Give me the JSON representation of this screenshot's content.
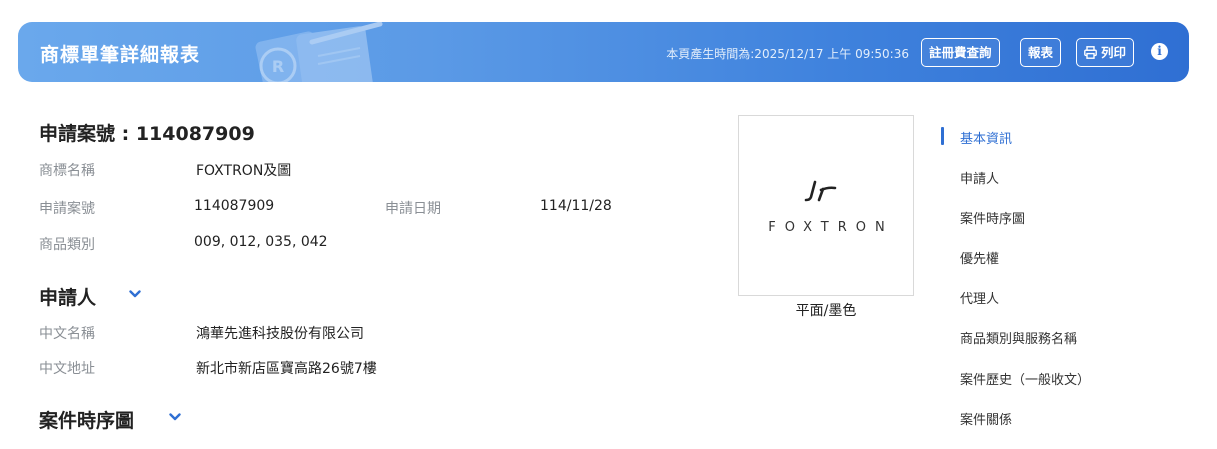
{
  "header": {
    "title": "商標單筆詳細報表",
    "timestamp": "本頁產生時間為:2025/12/17 上午 09:50:36",
    "btn_fee": "註冊費查詢",
    "btn_report": "報表",
    "btn_print": "列印",
    "info_icon": "i"
  },
  "basic": {
    "heading": "申請案號 : 114087909",
    "trademark_name_label": "商標名稱",
    "trademark_name": "FOXTRON及圖",
    "app_no_label": "申請案號",
    "app_no": "114087909",
    "app_date_label": "申請日期",
    "app_date": "114/11/28",
    "class_label": "商品類別",
    "classes": "009, 012, 035, 042"
  },
  "applicant": {
    "heading": "申請人",
    "cn_name_label": "中文名稱",
    "cn_name": "鴻華先進科技股份有限公司",
    "cn_addr_label": "中文地址",
    "cn_addr": "新北市新店區寶高路26號7樓"
  },
  "timeline": {
    "heading": "案件時序圖"
  },
  "image": {
    "wordmark": "FOXTRON",
    "caption": "平面/墨色"
  },
  "toc": [
    "基本資訊",
    "申請人",
    "案件時序圖",
    "優先權",
    "代理人",
    "商品類別與服務名稱",
    "案件歷史（一般收文）",
    "案件關係"
  ],
  "colors": {
    "accent": "#2f6fd3",
    "header_start": "#6aa8ec",
    "header_end": "#2f6fd3"
  }
}
